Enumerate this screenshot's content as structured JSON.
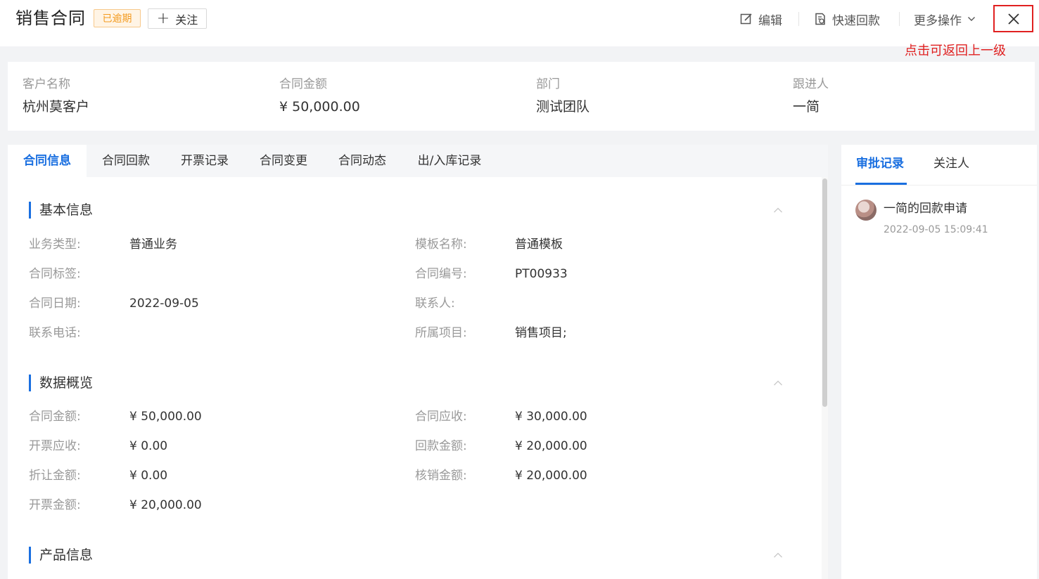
{
  "header": {
    "title": "销售合同",
    "status_badge": "已逾期",
    "follow_label": "关注",
    "actions": {
      "edit": "编辑",
      "quick_payment": "快速回款",
      "more": "更多操作"
    },
    "hint": "点击可返回上一级"
  },
  "summary": [
    {
      "label": "客户名称",
      "value": "杭州莫客户"
    },
    {
      "label": "合同金额",
      "value": "¥ 50,000.00"
    },
    {
      "label": "部门",
      "value": "测试团队"
    },
    {
      "label": "跟进人",
      "value": "一简"
    }
  ],
  "tabs": [
    "合同信息",
    "合同回款",
    "开票记录",
    "合同变更",
    "合同动态",
    "出/入库记录"
  ],
  "sections": {
    "basic": {
      "title": "基本信息",
      "fields": [
        {
          "label": "业务类型:",
          "value": "普通业务"
        },
        {
          "label": "模板名称:",
          "value": "普通模板"
        },
        {
          "label": "合同标签:",
          "value": ""
        },
        {
          "label": "合同编号:",
          "value": "PT00933"
        },
        {
          "label": "合同日期:",
          "value": "2022-09-05"
        },
        {
          "label": "联系人:",
          "value": ""
        },
        {
          "label": "联系电话:",
          "value": ""
        },
        {
          "label": "所属项目:",
          "value": "销售项目;"
        }
      ]
    },
    "overview": {
      "title": "数据概览",
      "fields": [
        {
          "label": "合同金额:",
          "value": "¥ 50,000.00"
        },
        {
          "label": "合同应收:",
          "value": "¥ 30,000.00"
        },
        {
          "label": "开票应收:",
          "value": "¥ 0.00"
        },
        {
          "label": "回款金额:",
          "value": "¥ 20,000.00"
        },
        {
          "label": "折让金额:",
          "value": "¥ 0.00"
        },
        {
          "label": "核销金额:",
          "value": "¥ 20,000.00"
        },
        {
          "label": "开票金额:",
          "value": "¥ 20,000.00"
        }
      ]
    },
    "products": {
      "title": "产品信息"
    }
  },
  "side": {
    "tabs": [
      "审批记录",
      "关注人"
    ],
    "record": {
      "title": "一简的回款申请",
      "time": "2022-09-05 15:09:41"
    }
  },
  "colors": {
    "accent": "#1a6fe0",
    "overdue_text": "#f39a1e",
    "highlight_red": "#e02020"
  }
}
